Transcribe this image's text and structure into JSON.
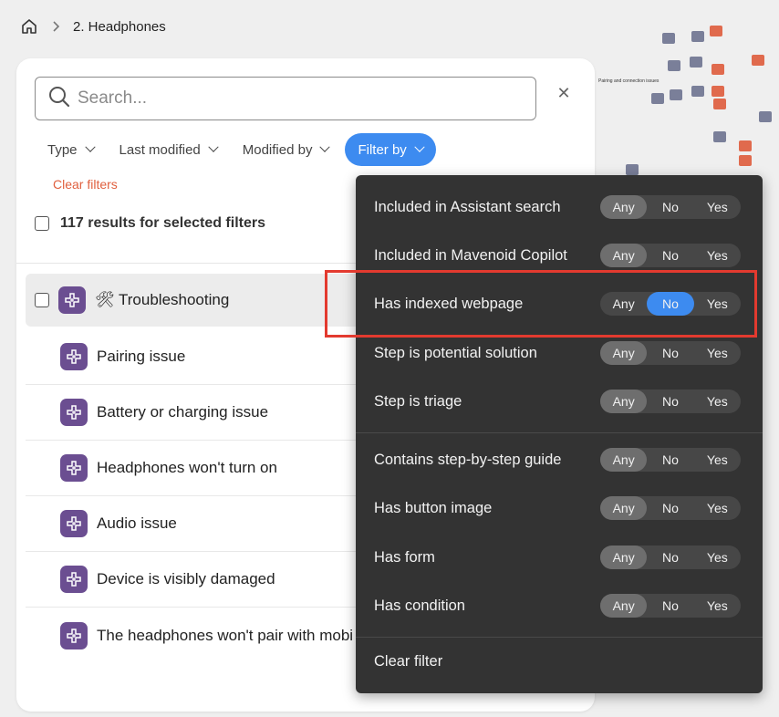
{
  "breadcrumb": {
    "home_icon": "home-icon",
    "separator_icon": "chevron-right-icon",
    "current": "2. Headphones"
  },
  "search": {
    "placeholder": "Search...",
    "value": ""
  },
  "close_icon": "close-icon",
  "filters": [
    {
      "label": "Type"
    },
    {
      "label": "Last modified"
    },
    {
      "label": "Modified by"
    },
    {
      "label": "Filter by"
    }
  ],
  "clear_filters": "Clear filters",
  "results": {
    "summary": "117 results for selected filters"
  },
  "list": {
    "parent": {
      "emoji": "🛠",
      "label": "Troubleshooting"
    },
    "children": [
      "Pairing issue",
      "Battery or charging issue",
      "Headphones won't turn on",
      "Audio issue",
      "Device is visibly damaged",
      "The headphones won't pair with mobi"
    ]
  },
  "dropdown": {
    "segment_labels": [
      "Any",
      "No",
      "Yes"
    ],
    "group1": [
      {
        "label": "Included in Assistant search",
        "selected": "Any"
      },
      {
        "label": "Included in Mavenoid Copilot",
        "selected": "Any"
      },
      {
        "label": "Has indexed webpage",
        "selected": "No"
      },
      {
        "label": "Step is potential solution",
        "selected": "Any"
      },
      {
        "label": "Step is triage",
        "selected": "Any"
      }
    ],
    "group2": [
      {
        "label": "Contains step-by-step guide",
        "selected": "Any"
      },
      {
        "label": "Has button image",
        "selected": "Any"
      },
      {
        "label": "Has form",
        "selected": "Any"
      },
      {
        "label": "Has condition",
        "selected": "Any"
      }
    ],
    "clear_filter": "Clear filter"
  },
  "canvas": {
    "label": "Pairing and connection issues"
  },
  "colors": {
    "accent": "#3d8bf0",
    "clear": "#e0603f",
    "highlight": "#e33a2f",
    "app_icon": "#6b4e91",
    "dropdown_bg": "#333333"
  }
}
